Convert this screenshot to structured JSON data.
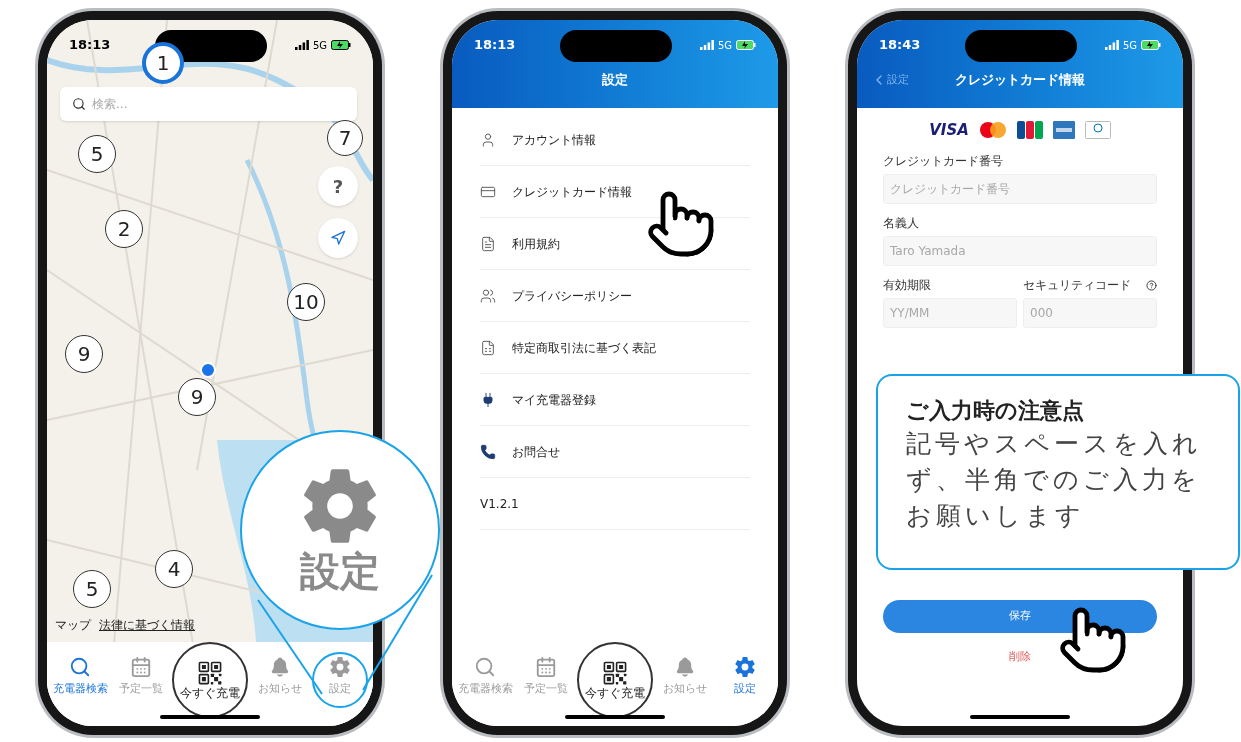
{
  "phone_map": {
    "status_bar": {
      "time": "18:13",
      "network": "5G"
    },
    "search": {
      "placeholder": "検索..."
    },
    "markers": [
      {
        "label": "1",
        "selected": true
      },
      {
        "label": "5",
        "selected": false
      },
      {
        "label": "7",
        "selected": false
      },
      {
        "label": "2",
        "selected": false
      },
      {
        "label": "10",
        "selected": false
      },
      {
        "label": "9",
        "selected": false
      },
      {
        "label": "9",
        "selected": false
      },
      {
        "label": "4",
        "selected": false
      },
      {
        "label": "5",
        "selected": false
      }
    ],
    "help_button": {
      "label": "?"
    },
    "attribution": {
      "brand": "マップ",
      "link": "法律に基づく情報"
    },
    "tab_bar": [
      {
        "label": "充電器検索",
        "selected": true,
        "kind": "tab"
      },
      {
        "label": "予定一覧",
        "selected": false,
        "kind": "tab"
      },
      {
        "label": "今すぐ充電",
        "selected": false,
        "kind": "qr"
      },
      {
        "label": "お知らせ",
        "selected": false,
        "kind": "tab"
      },
      {
        "label": "設定",
        "selected": false,
        "kind": "tab"
      }
    ],
    "zoom_callout": {
      "label": "設定"
    }
  },
  "phone_settings": {
    "status_bar": {
      "time": "18:13",
      "network": "5G"
    },
    "title": "設定",
    "items": [
      {
        "label": "アカウント情報",
        "kind": "link"
      },
      {
        "label": "クレジットカード情報",
        "kind": "link"
      },
      {
        "label": "利用規約",
        "kind": "link"
      },
      {
        "label": "プライバシーポリシー",
        "kind": "link"
      },
      {
        "label": "特定商取引法に基づく表記",
        "kind": "link"
      },
      {
        "label": "マイ充電器登録",
        "kind": "link"
      },
      {
        "label": "お問合せ",
        "kind": "link"
      },
      {
        "label": "V1.2.1",
        "kind": "version"
      }
    ],
    "tab_bar": [
      {
        "label": "充電器検索",
        "selected": false,
        "kind": "tab"
      },
      {
        "label": "予定一覧",
        "selected": false,
        "kind": "tab"
      },
      {
        "label": "今すぐ充電",
        "selected": false,
        "kind": "qr"
      },
      {
        "label": "お知らせ",
        "selected": false,
        "kind": "tab"
      },
      {
        "label": "設定",
        "selected": true,
        "kind": "tab"
      }
    ]
  },
  "phone_card": {
    "status_bar": {
      "time": "18:43",
      "network": "5G"
    },
    "back": "設定",
    "title": "クレジットカード情報",
    "visa": "VISA",
    "card_number": {
      "label": "クレジットカード番号",
      "placeholder": "クレジットカード番号"
    },
    "holder": {
      "label": "名義人",
      "placeholder": "Taro Yamada"
    },
    "expiry": {
      "label": "有効期限",
      "placeholder": "YY/MM"
    },
    "security_code": {
      "label": "セキュリティコード",
      "placeholder": "000"
    },
    "save": "保存",
    "delete": "削除",
    "note": {
      "title": "ご入力時の注意点",
      "body": "記号やスペースを入れず、半角でのご入力をお願いします"
    }
  }
}
